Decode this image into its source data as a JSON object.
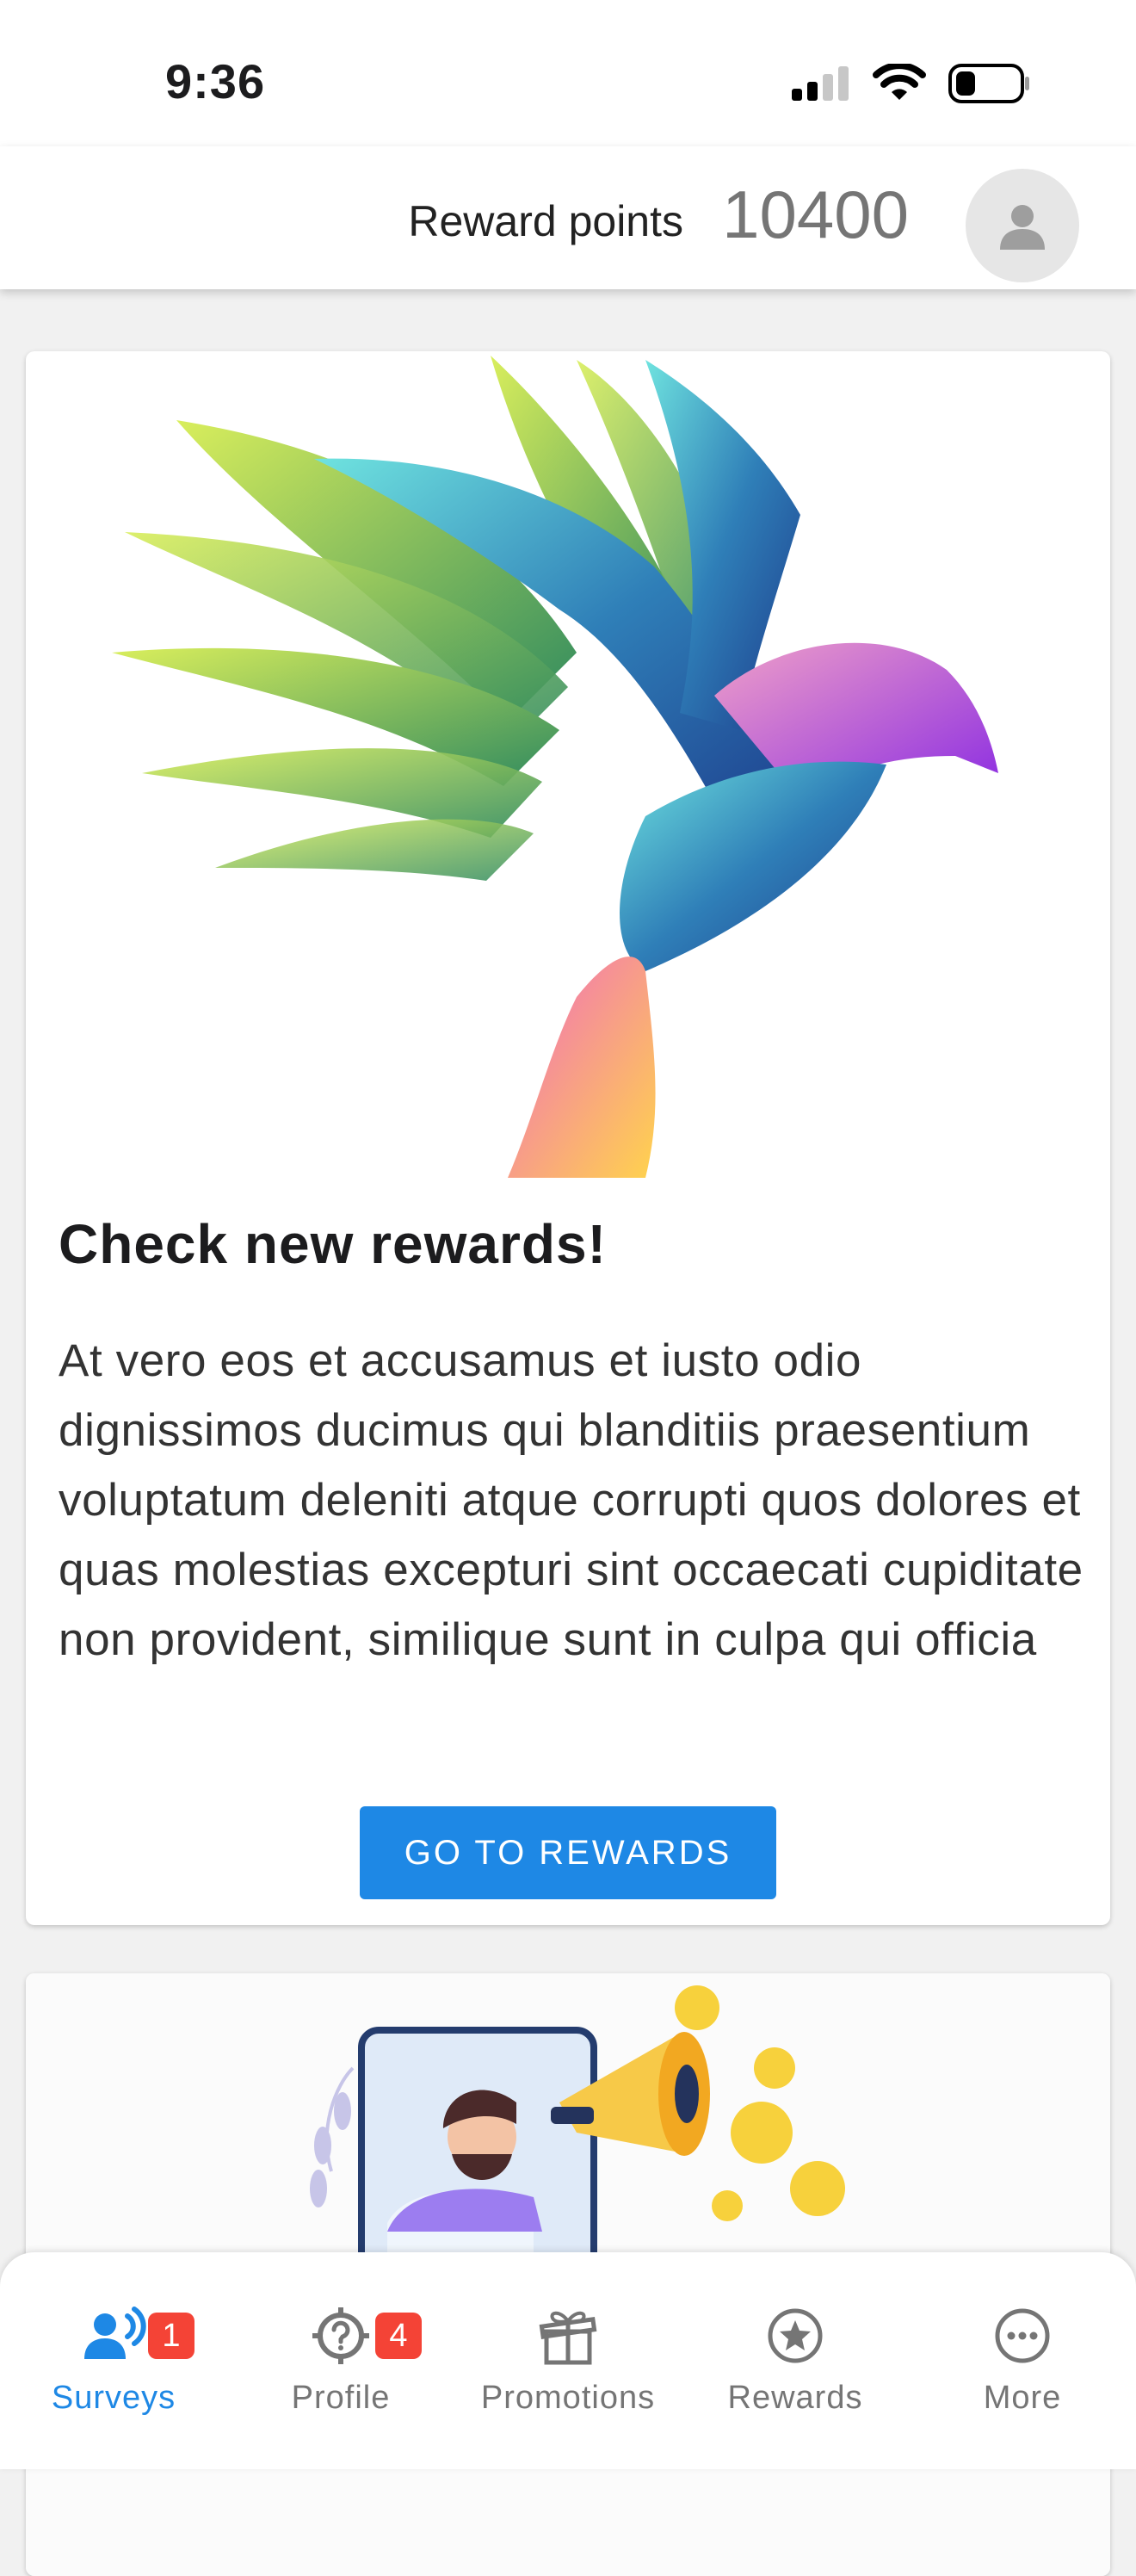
{
  "status_bar": {
    "time": "9:36"
  },
  "header": {
    "reward_label": "Reward points",
    "reward_value": "10400"
  },
  "cards": [
    {
      "title": "Check new rewards!",
      "body": "At vero eos et accusamus et iusto odio dignissimos ducimus qui blanditiis praesentium voluptatum deleniti atque corrupti quos dolores et quas molestias excepturi sint occaecati cupiditate non provident, similique sunt in culpa qui officia",
      "button_label": "GO TO REWARDS"
    }
  ],
  "tabs": [
    {
      "label": "Surveys",
      "icon": "survey-icon",
      "badge": "1",
      "active": true
    },
    {
      "label": "Profile",
      "icon": "question-target-icon",
      "badge": "4",
      "active": false
    },
    {
      "label": "Promotions",
      "icon": "gift-icon",
      "active": false
    },
    {
      "label": "Rewards",
      "icon": "star-circle-icon",
      "active": false
    },
    {
      "label": "More",
      "icon": "more-icon",
      "active": false
    }
  ],
  "colors": {
    "accent": "#1e88e5",
    "badge": "#f44336",
    "inactive": "#757575"
  }
}
